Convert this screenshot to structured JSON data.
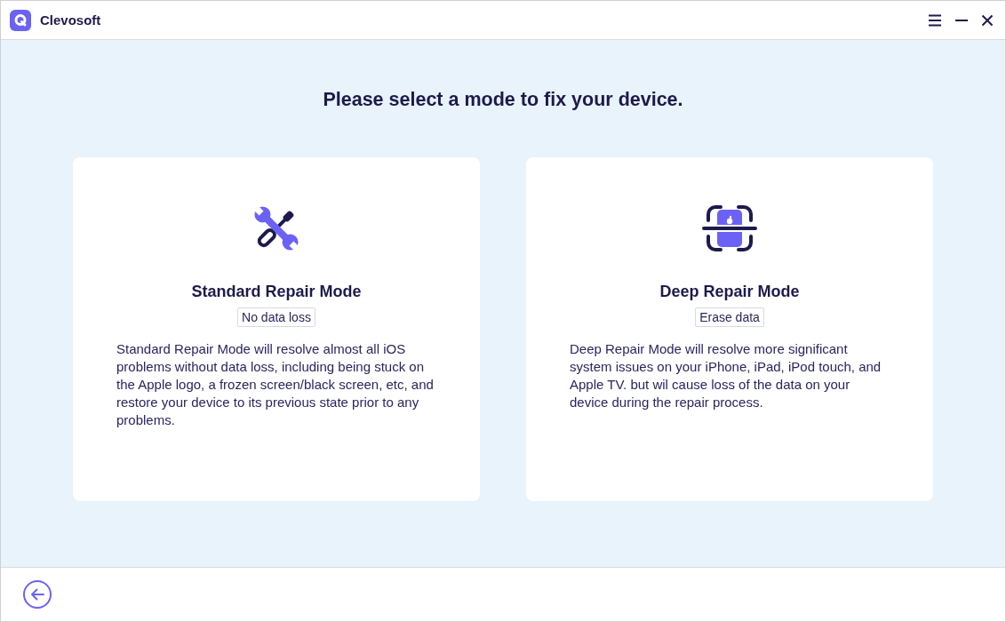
{
  "window": {
    "title": "Clevosoft"
  },
  "heading": "Please select a mode to fix your device.",
  "modes": [
    {
      "kind": "standard",
      "title": "Standard Repair Mode",
      "tag": "No data loss",
      "description": "Standard Repair Mode will resolve almost all iOS problems without data loss, including being stuck on the Apple logo, a frozen screen/black screen, etc, and restore your device to its previous state prior to any problems."
    },
    {
      "kind": "deep",
      "title": "Deep Repair Mode",
      "tag": "Erase data",
      "description": "Deep Repair Mode will resolve more significant system issues on your iPhone, iPad, iPod touch, and Apple TV. but wil cause loss of the data on your device during the repair process."
    }
  ]
}
